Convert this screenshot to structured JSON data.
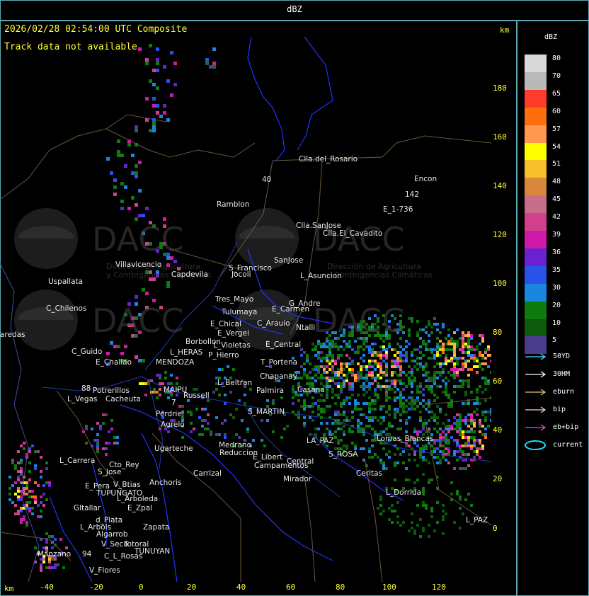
{
  "title": "dBZ",
  "header": {
    "timestamp": "2026/02/28 02:54:00 UTC Composite",
    "track_note": "Track data not available",
    "unit_top": "km",
    "unit_bottom": "km"
  },
  "y_ticks": [
    "180",
    "160",
    "140",
    "120",
    "100",
    "80",
    "60",
    "40",
    "20",
    "0"
  ],
  "x_ticks": [
    "-40",
    "-20",
    "0",
    "20",
    "40",
    "60",
    "80",
    "100",
    "120"
  ],
  "places": [
    {
      "name": "Clla.del_Rosario"
    },
    {
      "name": "Encon"
    },
    {
      "name": "142"
    },
    {
      "name": "E_1-736"
    },
    {
      "name": "Ramblon"
    },
    {
      "name": "Clla.SanJose"
    },
    {
      "name": "Clla.El_Cavadito"
    },
    {
      "name": "Villavicencio"
    },
    {
      "name": "S_Francisco"
    },
    {
      "name": "SanJose"
    },
    {
      "name": "Uspallata"
    },
    {
      "name": "Capdevila"
    },
    {
      "name": "Jocoli"
    },
    {
      "name": "L_Asuncion"
    },
    {
      "name": "Tres_Mayo"
    },
    {
      "name": "G_Andre"
    },
    {
      "name": "C_Chilenos"
    },
    {
      "name": "Tulumaya"
    },
    {
      "name": "E_Carmen"
    },
    {
      "name": "E_Chical"
    },
    {
      "name": "C_Arauio"
    },
    {
      "name": "Ntalli"
    },
    {
      "name": "aredas"
    },
    {
      "name": "E_Vergel"
    },
    {
      "name": "Borbollon"
    },
    {
      "name": "L_Violetas"
    },
    {
      "name": "E_Central"
    },
    {
      "name": "L_HERAS"
    },
    {
      "name": "P_Hierro"
    },
    {
      "name": "C_Guido"
    },
    {
      "name": "E_Challao"
    },
    {
      "name": "MENDOZA"
    },
    {
      "name": "T_Portena"
    },
    {
      "name": "Chapanay"
    },
    {
      "name": "L_Beltran"
    },
    {
      "name": "Palmira"
    },
    {
      "name": "Casana"
    },
    {
      "name": "Potrerillos"
    },
    {
      "name": "L_Vegas"
    },
    {
      "name": "Cacheuta"
    },
    {
      "name": "MAIPU"
    },
    {
      "name": "Russell"
    },
    {
      "name": "S_MARTIN"
    },
    {
      "name": "Perdriel"
    },
    {
      "name": "Agrelo"
    },
    {
      "name": "Ugarteche"
    },
    {
      "name": "LA_PAZ"
    },
    {
      "name": "Lomas_Blancas"
    },
    {
      "name": "L_Carrera"
    },
    {
      "name": "Cto_Rey"
    },
    {
      "name": "S_Jose"
    },
    {
      "name": "Medrano"
    },
    {
      "name": "Reduccion"
    },
    {
      "name": "E_Libert"
    },
    {
      "name": "Campamentos"
    },
    {
      "name": "Central"
    },
    {
      "name": "S_ROSA"
    },
    {
      "name": "Ceritas"
    },
    {
      "name": "Carrizal"
    },
    {
      "name": "E_Pera"
    },
    {
      "name": "V_Btias"
    },
    {
      "name": "Anchoris"
    },
    {
      "name": "TUPUNGATO"
    },
    {
      "name": "L_Arboleda"
    },
    {
      "name": "Gltallar"
    },
    {
      "name": "E_Zpal"
    },
    {
      "name": "Mirador"
    },
    {
      "name": "L_Dorrida"
    },
    {
      "name": "L_Arbols"
    },
    {
      "name": "d_Plata"
    },
    {
      "name": "Zapata"
    },
    {
      "name": "Algarrob"
    },
    {
      "name": "V_Seco"
    },
    {
      "name": "Totoral"
    },
    {
      "name": "TUNUYAN"
    },
    {
      "name": "C_L_Rosas"
    },
    {
      "name": "Manzano"
    },
    {
      "name": "V_Flores"
    },
    {
      "name": "L_PAZ"
    },
    {
      "name": "94"
    },
    {
      "name": "88"
    },
    {
      "name": "40"
    },
    {
      "name": "7"
    }
  ],
  "watermark": {
    "brand": "DACC",
    "line1": "Dirección de Agricultura",
    "line2": "y Contingencias Climáticas"
  },
  "legend": {
    "title": "dBZ",
    "levels": [
      {
        "label": "80",
        "color": "#d9d9d9"
      },
      {
        "label": "70",
        "color": "#b9b9b9"
      },
      {
        "label": "65",
        "color": "#ff3b2a"
      },
      {
        "label": "60",
        "color": "#ff6e0e"
      },
      {
        "label": "57",
        "color": "#ff9850"
      },
      {
        "label": "54",
        "color": "#ffff00"
      },
      {
        "label": "51",
        "color": "#f5c02a"
      },
      {
        "label": "48",
        "color": "#d8873b"
      },
      {
        "label": "45",
        "color": "#c86e8a"
      },
      {
        "label": "42",
        "color": "#d1418b"
      },
      {
        "label": "39",
        "color": "#cf1aa9"
      },
      {
        "label": "36",
        "color": "#6a22d0"
      },
      {
        "label": "35",
        "color": "#2a52e8"
      },
      {
        "label": "30",
        "color": "#1a86e0"
      },
      {
        "label": "20",
        "color": "#0f7a0f"
      },
      {
        "label": "10",
        "color": "#0d5a0d"
      },
      {
        "label": "5",
        "color": "#4a3b8d"
      }
    ],
    "tracks": [
      {
        "label": "50YD",
        "color": "#4ee0ff"
      },
      {
        "label": "30HM",
        "color": "#ffffff"
      },
      {
        "label": "eburn",
        "color": "#f0c070"
      },
      {
        "label": "bip",
        "color": "#ffd0e0"
      },
      {
        "label": "eb+bip",
        "color": "#ff40ff"
      },
      {
        "label": "current",
        "color": "#20e0ff"
      }
    ]
  }
}
